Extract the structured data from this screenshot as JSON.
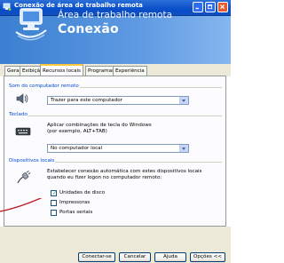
{
  "window": {
    "title": "Conexão de área de trabalho remota",
    "controls": [
      "minimize",
      "maximize",
      "close"
    ]
  },
  "header": {
    "line1": "Área de trabalho remota",
    "line2": "Conexão"
  },
  "tabs": [
    {
      "label": "Geral",
      "active": false
    },
    {
      "label": "Exibição",
      "active": false
    },
    {
      "label": "Recursos locais",
      "active": true
    },
    {
      "label": "Programas",
      "active": false
    },
    {
      "label": "Experiência",
      "active": false
    }
  ],
  "sound": {
    "group_title": "Som do computador remoto",
    "selected": "Trazer para este computador"
  },
  "keyboard": {
    "group_title": "Teclado",
    "description_line1": "Aplicar combinações de tecla do Windows",
    "description_line2": "(por exemplo, ALT+TAB)",
    "selected": "No computador local"
  },
  "devices": {
    "group_title": "Dispositivos locais",
    "description_line1": "Estabelecer conexão automática com estes dispositivos locais",
    "description_line2": "quando eu fizer logon no computador remoto:",
    "options": [
      {
        "label": "Unidades de disco",
        "checked": true
      },
      {
        "label": "Impressoras",
        "checked": false
      },
      {
        "label": "Portas seriais",
        "checked": false
      }
    ]
  },
  "buttons": {
    "connect": "Conectar-se",
    "cancel": "Cancelar",
    "help": "Ajuda",
    "options": "Opções <<"
  },
  "colors": {
    "titlebar": "#0a4ec9",
    "group_title": "#0046d5",
    "pointer": "#c0202a",
    "active_tab_highlight": "#ffc73c"
  }
}
